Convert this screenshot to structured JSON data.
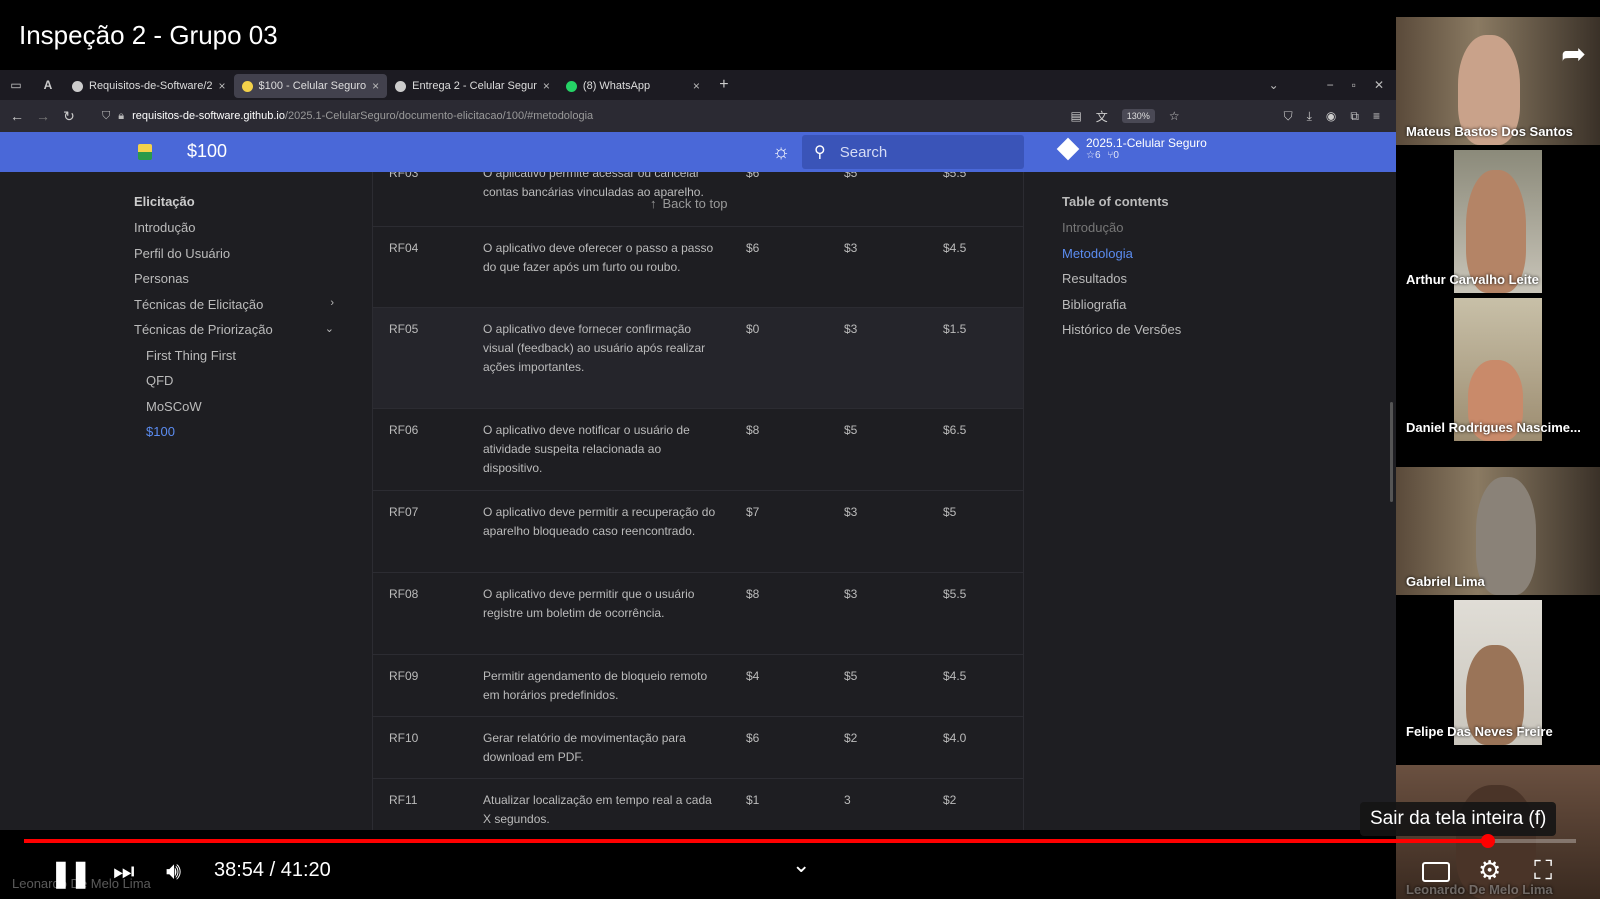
{
  "video": {
    "title": "Inspeção 2 - Grupo 03",
    "time_current": "38:54",
    "time_total": "41:20",
    "time_separator": "/",
    "progress_fraction": 0.9435,
    "tooltip": "Sair da tela inteira (f)",
    "watermark": "Leonardo De Melo Lima"
  },
  "browser": {
    "tabs": [
      {
        "label": "Requisitos-de-Software/2",
        "active": false,
        "favicon_color": "#cccccc"
      },
      {
        "label": "$100 - Celular Seguro",
        "active": true,
        "favicon_color": "#f4d24a"
      },
      {
        "label": "Entrega 2 - Celular Segur",
        "active": false,
        "favicon_color": "#cccccc"
      },
      {
        "label": "(8) WhatsApp",
        "active": false,
        "favicon_color": "#25d366"
      }
    ],
    "url_host": "requisitos-de-software.github.io",
    "url_path": "/2025.1-CelularSeguro/documento-elicitacao/100/#metodologia",
    "zoom": "130%"
  },
  "site": {
    "title": "$100",
    "search_placeholder": "Search",
    "repo_name": "2025.1-Celular Seguro",
    "repo_stars": "6",
    "repo_forks": "0"
  },
  "sidebar": {
    "heading": "Elicitação",
    "items": [
      {
        "label": "Introdução"
      },
      {
        "label": "Perfil do Usuário"
      },
      {
        "label": "Personas"
      },
      {
        "label": "Técnicas de Elicitação"
      },
      {
        "label": "Técnicas de Priorização"
      },
      {
        "label": "First Thing First"
      },
      {
        "label": "QFD"
      },
      {
        "label": "MoSCoW"
      },
      {
        "label": "$100"
      }
    ]
  },
  "back_to_top": "Back to top",
  "table": {
    "rows": [
      {
        "id": "RF03",
        "desc": "O aplicativo permite acessar ou cancelar contas bancárias vinculadas ao aparelho.",
        "v1": "$6",
        "v2": "$5",
        "v3": "$5.5"
      },
      {
        "id": "RF04",
        "desc": "O aplicativo deve oferecer o passo a passo do que fazer após um furto ou roubo.",
        "v1": "$6",
        "v2": "$3",
        "v3": "$4.5"
      },
      {
        "id": "RF05",
        "desc": "O aplicativo deve fornecer confirmação visual (feedback) ao usuário após realizar ações importantes.",
        "v1": "$0",
        "v2": "$3",
        "v3": "$1.5"
      },
      {
        "id": "RF06",
        "desc": "O aplicativo deve notificar o usuário de atividade suspeita relacionada ao dispositivo.",
        "v1": "$8",
        "v2": "$5",
        "v3": "$6.5"
      },
      {
        "id": "RF07",
        "desc": "O aplicativo deve permitir a recuperação do aparelho bloqueado caso reencontrado.",
        "v1": "$7",
        "v2": "$3",
        "v3": "$5"
      },
      {
        "id": "RF08",
        "desc": "O aplicativo deve permitir que o usuário registre um boletim de ocorrência.",
        "v1": "$8",
        "v2": "$3",
        "v3": "$5.5"
      },
      {
        "id": "RF09",
        "desc": "Permitir agendamento de bloqueio remoto em horários predefinidos.",
        "v1": "$4",
        "v2": "$5",
        "v3": "$4.5"
      },
      {
        "id": "RF10",
        "desc": "Gerar relatório de movimentação para download em PDF.",
        "v1": "$6",
        "v2": "$2",
        "v3": "$4.0"
      },
      {
        "id": "RF11",
        "desc": "Atualizar localização em tempo real a cada X segundos.",
        "v1": "$1",
        "v2": "3",
        "v3": "$2"
      }
    ]
  },
  "toc": {
    "heading": "Table of contents",
    "items": [
      {
        "label": "Introdução"
      },
      {
        "label": "Metodologia"
      },
      {
        "label": "Resultados"
      },
      {
        "label": "Bibliografia"
      },
      {
        "label": "Histórico de Versões"
      }
    ]
  },
  "participants": [
    {
      "name": "Mateus Bastos Dos Santos"
    },
    {
      "name": "Arthur Carvalho Leite"
    },
    {
      "name": "Daniel Rodrigues Nascime..."
    },
    {
      "name": "Gabriel Lima"
    },
    {
      "name": "Felipe Das Neves Freire"
    },
    {
      "name": "Leonardo De Melo Lima"
    }
  ],
  "colors": {
    "header_blue": "#4a68d8",
    "link_blue": "#5b8cf0",
    "progress_red": "#ff0000"
  }
}
